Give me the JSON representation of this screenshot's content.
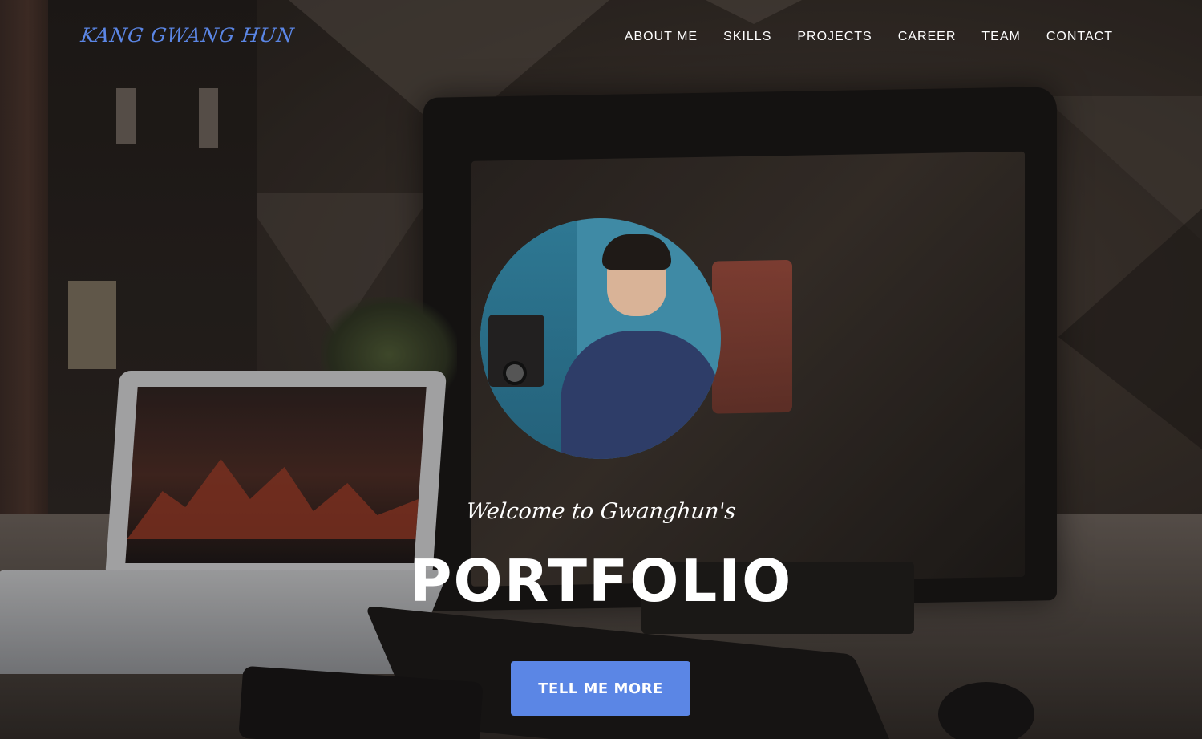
{
  "nav": {
    "brand": "KANG GWANG HUN",
    "items": [
      {
        "label": "ABOUT ME"
      },
      {
        "label": "SKILLS"
      },
      {
        "label": "PROJECTS"
      },
      {
        "label": "CAREER"
      },
      {
        "label": "TEAM"
      },
      {
        "label": "CONTACT"
      }
    ]
  },
  "hero": {
    "welcome": "Welcome to Gwanghun's",
    "title": "PORTFOLIO",
    "cta_label": "TELL ME MORE",
    "avatar_icon": "profile-photo"
  },
  "colors": {
    "accent": "#5b86e5",
    "text": "#ffffff",
    "background": "#2b2520"
  }
}
